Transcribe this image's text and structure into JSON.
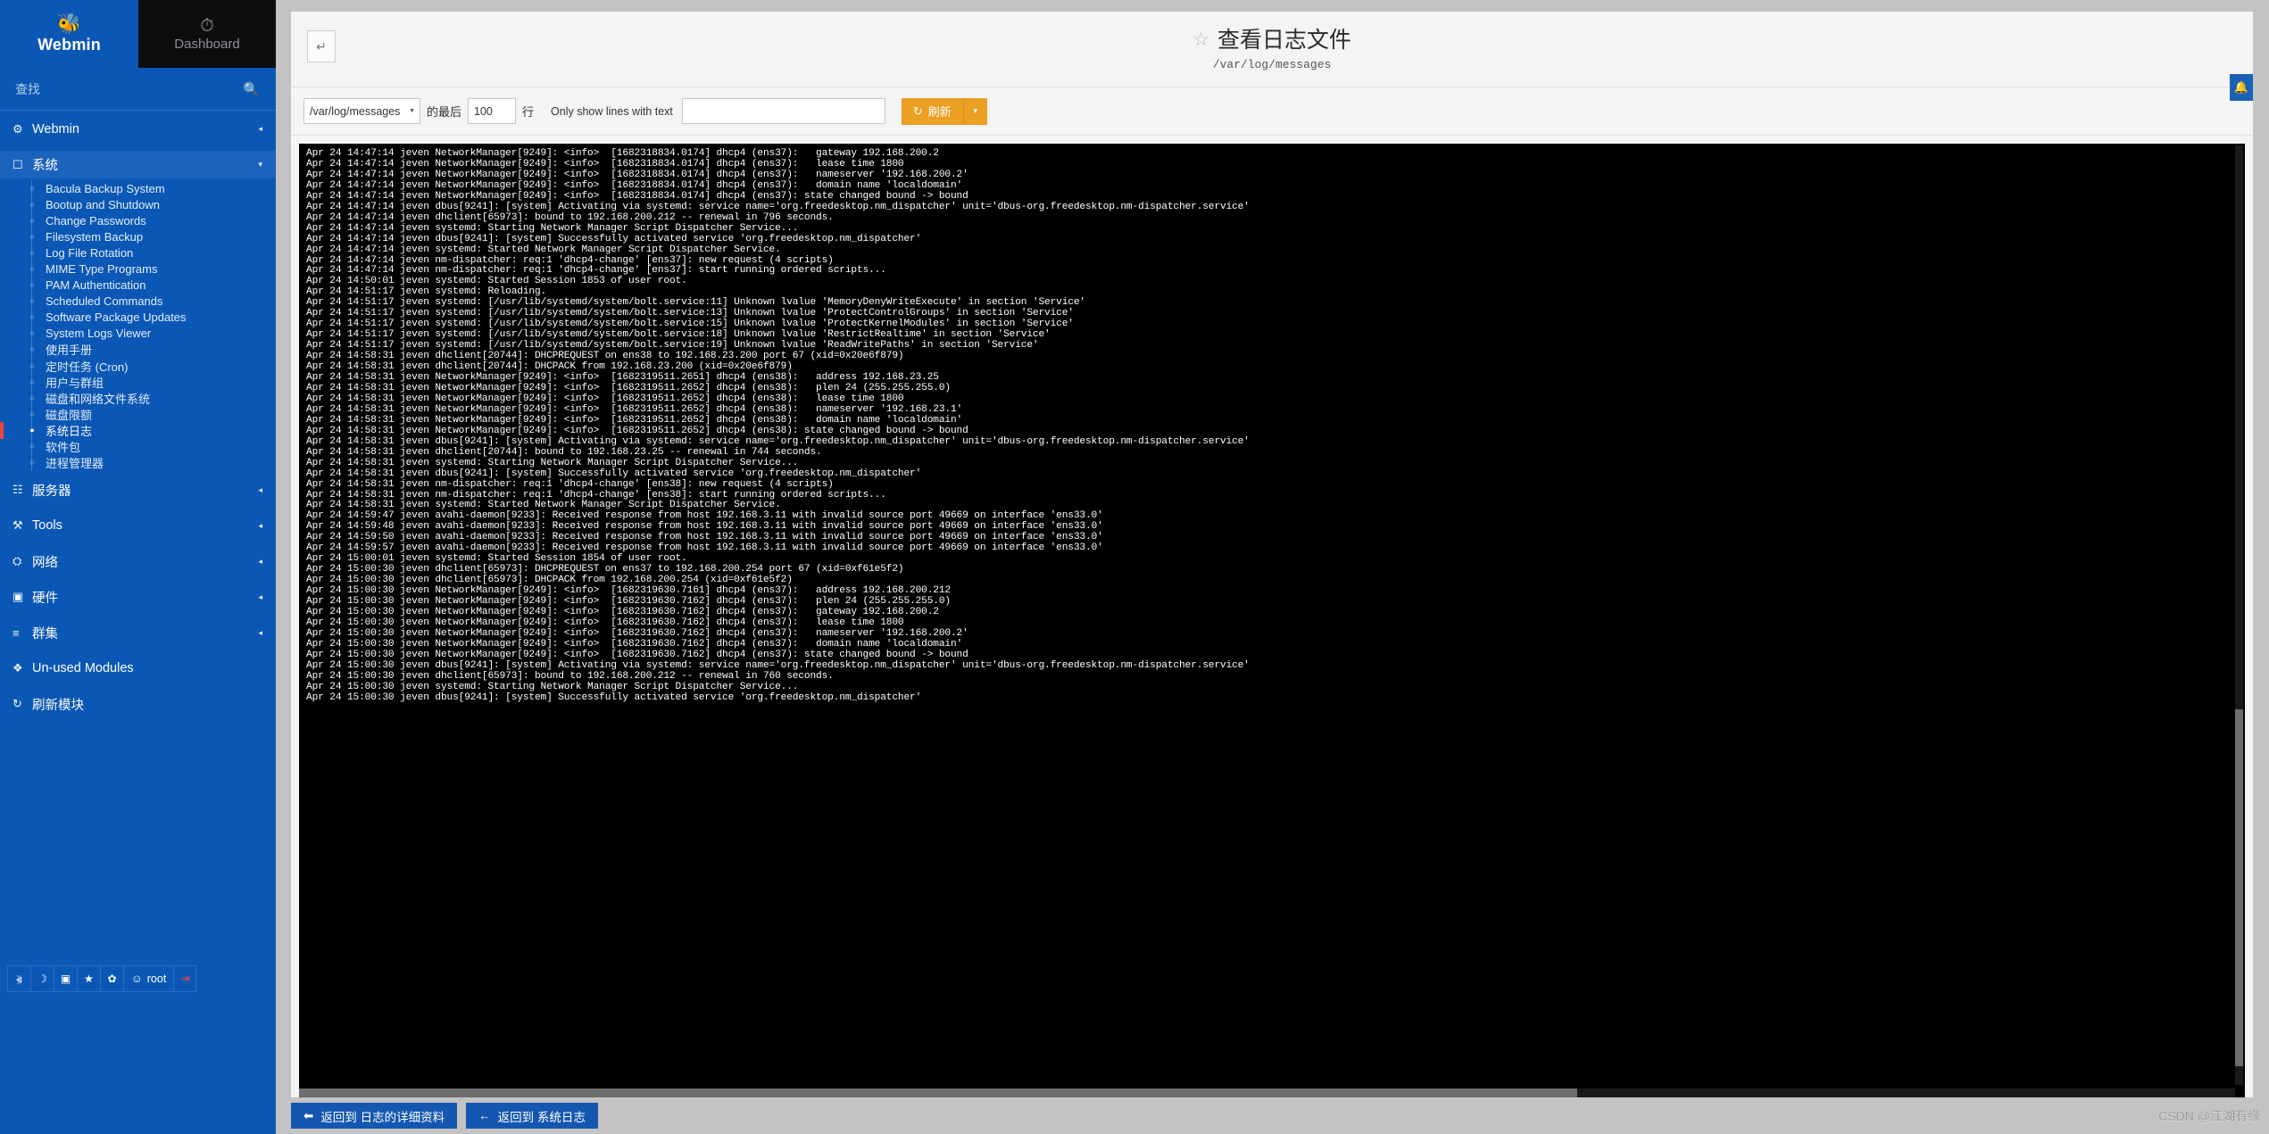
{
  "brand": {
    "logo_icon": "webmin-logo-icon",
    "name": "Webmin",
    "dashboard_icon": "gauge-icon",
    "dashboard_label": "Dashboard"
  },
  "search": {
    "placeholder": "查找",
    "icon": "search-icon"
  },
  "sidebar": {
    "groups": [
      {
        "icon": "gear-icon",
        "label": "Webmin",
        "arrow": "◂",
        "open": false,
        "items": []
      },
      {
        "icon": "laptop-icon",
        "label": "系统",
        "arrow": "▾",
        "open": true,
        "items": [
          "Bacula Backup System",
          "Bootup and Shutdown",
          "Change Passwords",
          "Filesystem Backup",
          "Log File Rotation",
          "MIME Type Programs",
          "PAM Authentication",
          "Scheduled Commands",
          "Software Package Updates",
          "System Logs Viewer",
          "使用手册",
          "定时任务 (Cron)",
          "用户与群组",
          "磁盘和网络文件系统",
          "磁盘限额",
          "系统日志",
          "软件包",
          "进程管理器"
        ],
        "active_index": 15
      },
      {
        "icon": "server-icon",
        "label": "服务器",
        "arrow": "◂",
        "open": false,
        "items": []
      },
      {
        "icon": "tools-icon",
        "label": "Tools",
        "arrow": "◂",
        "open": false,
        "items": []
      },
      {
        "icon": "network-icon",
        "label": "网络",
        "arrow": "◂",
        "open": false,
        "items": []
      },
      {
        "icon": "hardware-icon",
        "label": "硬件",
        "arrow": "◂",
        "open": false,
        "items": []
      },
      {
        "icon": "cluster-icon",
        "label": "群集",
        "arrow": "◂",
        "open": false,
        "items": []
      },
      {
        "icon": "unused-modules-icon",
        "label": "Un-used Modules",
        "arrow": "",
        "open": false,
        "items": []
      },
      {
        "icon": "refresh-icon",
        "label": "刷新模块",
        "arrow": "",
        "open": false,
        "items": []
      }
    ],
    "footer_buttons": [
      {
        "icon": "collapse-sidebar-icon",
        "label": ""
      },
      {
        "icon": "moon-icon",
        "label": ""
      },
      {
        "icon": "terminal-icon",
        "label": ""
      },
      {
        "icon": "star-icon",
        "label": ""
      },
      {
        "icon": "palette-icon",
        "label": ""
      },
      {
        "icon": "user-gear-icon",
        "label": "root"
      },
      {
        "icon": "logout-icon",
        "label": ""
      }
    ]
  },
  "header": {
    "back_icon": "return-arrow-icon",
    "star_icon": "star-outline-icon",
    "title": "查看日志文件",
    "subtitle": "/var/log/messages",
    "notify_icon": "bell-icon"
  },
  "toolbar": {
    "file_select_value": "/var/log/messages",
    "file_select_options": [
      "/var/log/messages"
    ],
    "label_last": "的最后",
    "lines_value": "100",
    "label_lines": "行",
    "filter_label": "Only show lines with text",
    "filter_value": "",
    "refresh_icon": "refresh-cw-icon",
    "refresh_label": "刷新",
    "refresh_caret": "▾"
  },
  "footer": {
    "buttons": [
      {
        "icon": "circle-left-arrow-icon",
        "label": "返回到 日志的详细资料"
      },
      {
        "icon": "left-arrow-icon",
        "label": "返回到 系统日志"
      }
    ]
  },
  "watermark": "CSDN @江湖有缘",
  "log": {
    "lines": [
      "Apr 24 14:47:14 jeven NetworkManager[9249]: <info>  [1682318834.0174] dhcp4 (ens37):   gateway 192.168.200.2",
      "Apr 24 14:47:14 jeven NetworkManager[9249]: <info>  [1682318834.0174] dhcp4 (ens37):   lease time 1800",
      "Apr 24 14:47:14 jeven NetworkManager[9249]: <info>  [1682318834.0174] dhcp4 (ens37):   nameserver '192.168.200.2'",
      "Apr 24 14:47:14 jeven NetworkManager[9249]: <info>  [1682318834.0174] dhcp4 (ens37):   domain name 'localdomain'",
      "Apr 24 14:47:14 jeven NetworkManager[9249]: <info>  [1682318834.0174] dhcp4 (ens37): state changed bound -> bound",
      "Apr 24 14:47:14 jeven dbus[9241]: [system] Activating via systemd: service name='org.freedesktop.nm_dispatcher' unit='dbus-org.freedesktop.nm-dispatcher.service'",
      "Apr 24 14:47:14 jeven dhclient[65973]: bound to 192.168.200.212 -- renewal in 796 seconds.",
      "Apr 24 14:47:14 jeven systemd: Starting Network Manager Script Dispatcher Service...",
      "Apr 24 14:47:14 jeven dbus[9241]: [system] Successfully activated service 'org.freedesktop.nm_dispatcher'",
      "Apr 24 14:47:14 jeven systemd: Started Network Manager Script Dispatcher Service.",
      "Apr 24 14:47:14 jeven nm-dispatcher: req:1 'dhcp4-change' [ens37]: new request (4 scripts)",
      "Apr 24 14:47:14 jeven nm-dispatcher: req:1 'dhcp4-change' [ens37]: start running ordered scripts...",
      "Apr 24 14:50:01 jeven systemd: Started Session 1853 of user root.",
      "Apr 24 14:51:17 jeven systemd: Reloading.",
      "Apr 24 14:51:17 jeven systemd: [/usr/lib/systemd/system/bolt.service:11] Unknown lvalue 'MemoryDenyWriteExecute' in section 'Service'",
      "Apr 24 14:51:17 jeven systemd: [/usr/lib/systemd/system/bolt.service:13] Unknown lvalue 'ProtectControlGroups' in section 'Service'",
      "Apr 24 14:51:17 jeven systemd: [/usr/lib/systemd/system/bolt.service:15] Unknown lvalue 'ProtectKernelModules' in section 'Service'",
      "Apr 24 14:51:17 jeven systemd: [/usr/lib/systemd/system/bolt.service:18] Unknown lvalue 'RestrictRealtime' in section 'Service'",
      "Apr 24 14:51:17 jeven systemd: [/usr/lib/systemd/system/bolt.service:19] Unknown lvalue 'ReadWritePaths' in section 'Service'",
      "Apr 24 14:58:31 jeven dhclient[20744]: DHCPREQUEST on ens38 to 192.168.23.200 port 67 (xid=0x20e6f879)",
      "Apr 24 14:58:31 jeven dhclient[20744]: DHCPACK from 192.168.23.200 (xid=0x20e6f879)",
      "Apr 24 14:58:31 jeven NetworkManager[9249]: <info>  [1682319511.2651] dhcp4 (ens38):   address 192.168.23.25",
      "Apr 24 14:58:31 jeven NetworkManager[9249]: <info>  [1682319511.2652] dhcp4 (ens38):   plen 24 (255.255.255.0)",
      "Apr 24 14:58:31 jeven NetworkManager[9249]: <info>  [1682319511.2652] dhcp4 (ens38):   lease time 1800",
      "Apr 24 14:58:31 jeven NetworkManager[9249]: <info>  [1682319511.2652] dhcp4 (ens38):   nameserver '192.168.23.1'",
      "Apr 24 14:58:31 jeven NetworkManager[9249]: <info>  [1682319511.2652] dhcp4 (ens38):   domain name 'localdomain'",
      "Apr 24 14:58:31 jeven NetworkManager[9249]: <info>  [1682319511.2652] dhcp4 (ens38): state changed bound -> bound",
      "Apr 24 14:58:31 jeven dbus[9241]: [system] Activating via systemd: service name='org.freedesktop.nm_dispatcher' unit='dbus-org.freedesktop.nm-dispatcher.service'",
      "Apr 24 14:58:31 jeven dhclient[20744]: bound to 192.168.23.25 -- renewal in 744 seconds.",
      "Apr 24 14:58:31 jeven systemd: Starting Network Manager Script Dispatcher Service...",
      "Apr 24 14:58:31 jeven dbus[9241]: [system] Successfully activated service 'org.freedesktop.nm_dispatcher'",
      "Apr 24 14:58:31 jeven nm-dispatcher: req:1 'dhcp4-change' [ens38]: new request (4 scripts)",
      "Apr 24 14:58:31 jeven nm-dispatcher: req:1 'dhcp4-change' [ens38]: start running ordered scripts...",
      "Apr 24 14:58:31 jeven systemd: Started Network Manager Script Dispatcher Service.",
      "Apr 24 14:59:47 jeven avahi-daemon[9233]: Received response from host 192.168.3.11 with invalid source port 49669 on interface 'ens33.0'",
      "Apr 24 14:59:48 jeven avahi-daemon[9233]: Received response from host 192.168.3.11 with invalid source port 49669 on interface 'ens33.0'",
      "Apr 24 14:59:50 jeven avahi-daemon[9233]: Received response from host 192.168.3.11 with invalid source port 49669 on interface 'ens33.0'",
      "Apr 24 14:59:57 jeven avahi-daemon[9233]: Received response from host 192.168.3.11 with invalid source port 49669 on interface 'ens33.0'",
      "Apr 24 15:00:01 jeven systemd: Started Session 1854 of user root.",
      "Apr 24 15:00:30 jeven dhclient[65973]: DHCPREQUEST on ens37 to 192.168.200.254 port 67 (xid=0xf61e5f2)",
      "Apr 24 15:00:30 jeven dhclient[65973]: DHCPACK from 192.168.200.254 (xid=0xf61e5f2)",
      "Apr 24 15:00:30 jeven NetworkManager[9249]: <info>  [1682319630.7161] dhcp4 (ens37):   address 192.168.200.212",
      "Apr 24 15:00:30 jeven NetworkManager[9249]: <info>  [1682319630.7162] dhcp4 (ens37):   plen 24 (255.255.255.0)",
      "Apr 24 15:00:30 jeven NetworkManager[9249]: <info>  [1682319630.7162] dhcp4 (ens37):   gateway 192.168.200.2",
      "Apr 24 15:00:30 jeven NetworkManager[9249]: <info>  [1682319630.7162] dhcp4 (ens37):   lease time 1800",
      "Apr 24 15:00:30 jeven NetworkManager[9249]: <info>  [1682319630.7162] dhcp4 (ens37):   nameserver '192.168.200.2'",
      "Apr 24 15:00:30 jeven NetworkManager[9249]: <info>  [1682319630.7162] dhcp4 (ens37):   domain name 'localdomain'",
      "Apr 24 15:00:30 jeven NetworkManager[9249]: <info>  [1682319630.7162] dhcp4 (ens37): state changed bound -> bound",
      "Apr 24 15:00:30 jeven dbus[9241]: [system] Activating via systemd: service name='org.freedesktop.nm_dispatcher' unit='dbus-org.freedesktop.nm-dispatcher.service'",
      "Apr 24 15:00:30 jeven dhclient[65973]: bound to 192.168.200.212 -- renewal in 760 seconds.",
      "Apr 24 15:00:30 jeven systemd: Starting Network Manager Script Dispatcher Service...",
      "Apr 24 15:00:30 jeven dbus[9241]: [system] Successfully activated service 'org.freedesktop.nm_dispatcher'"
    ]
  },
  "colors": {
    "brand_blue": "#0b57b5",
    "accent_orange": "#eb9f23",
    "active_red": "#e8453c",
    "button_blue": "#1557b0"
  }
}
